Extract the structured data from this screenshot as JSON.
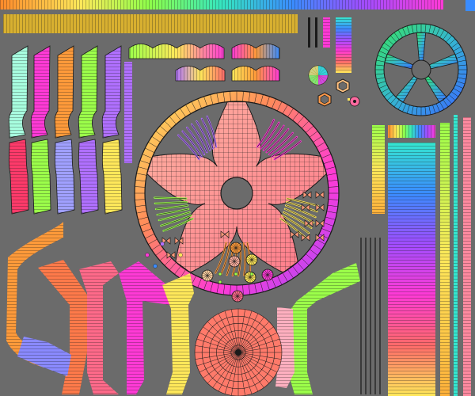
{
  "viewport": {
    "background": "#6b6b6b"
  },
  "atlas": {
    "kind": "uv-texture-atlas",
    "subject": "car wheel rim",
    "palette": [
      "#ff4a4a",
      "#ffa23a",
      "#ffe85a",
      "#9cff4a",
      "#36e06a",
      "#35e6d0",
      "#3a8cff",
      "#8a4dff",
      "#ff3ad6",
      "#ff6aa0"
    ],
    "wire_color": "#1a1a1a",
    "islands": [
      {
        "name": "top-gradient-strip"
      },
      {
        "name": "top-band"
      },
      {
        "name": "spoke-strips"
      },
      {
        "name": "wave-strips"
      },
      {
        "name": "small-vertical-bars"
      },
      {
        "name": "hub-icons"
      },
      {
        "name": "small-wheel"
      },
      {
        "name": "main-wheel-front"
      },
      {
        "name": "bolt-patterns"
      },
      {
        "name": "bottom-left-curves"
      },
      {
        "name": "bottom-circle"
      },
      {
        "name": "right-column-strips"
      },
      {
        "name": "black-lines"
      }
    ]
  }
}
